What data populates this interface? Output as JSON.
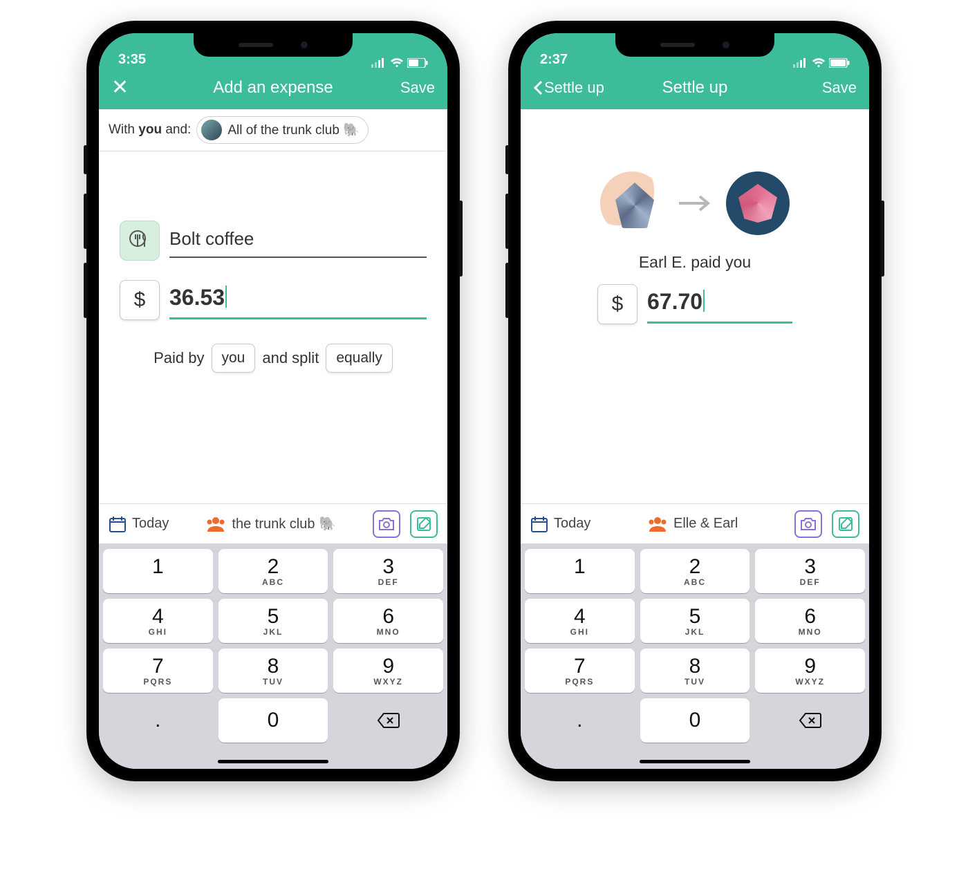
{
  "phones": {
    "expense": {
      "status_time": "3:35",
      "nav_title": "Add an expense",
      "save_label": "Save",
      "with_prefix": "With ",
      "with_you": "you",
      "with_suffix": " and:",
      "chip_label": "All of the trunk club 🐘",
      "description_value": "Bolt coffee",
      "currency_symbol": "$",
      "amount_value": "36.53",
      "split_paid_by_prefix": "Paid by",
      "split_payer": "you",
      "split_mid": "and split",
      "split_method": "equally",
      "date_label": "Today",
      "group_label": "the trunk club 🐘"
    },
    "settle": {
      "status_time": "2:37",
      "back_label": "Settle up",
      "nav_title": "Settle up",
      "save_label": "Save",
      "paid_text": "Earl E. paid you",
      "currency_symbol": "$",
      "amount_value": "67.70",
      "date_label": "Today",
      "group_label": "Elle & Earl"
    }
  },
  "keypad": [
    {
      "num": "1",
      "letters": ""
    },
    {
      "num": "2",
      "letters": "ABC"
    },
    {
      "num": "3",
      "letters": "DEF"
    },
    {
      "num": "4",
      "letters": "GHI"
    },
    {
      "num": "5",
      "letters": "JKL"
    },
    {
      "num": "6",
      "letters": "MNO"
    },
    {
      "num": "7",
      "letters": "PQRS"
    },
    {
      "num": "8",
      "letters": "TUV"
    },
    {
      "num": "9",
      "letters": "WXYZ"
    }
  ],
  "keypad_dot": ".",
  "keypad_zero": "0"
}
